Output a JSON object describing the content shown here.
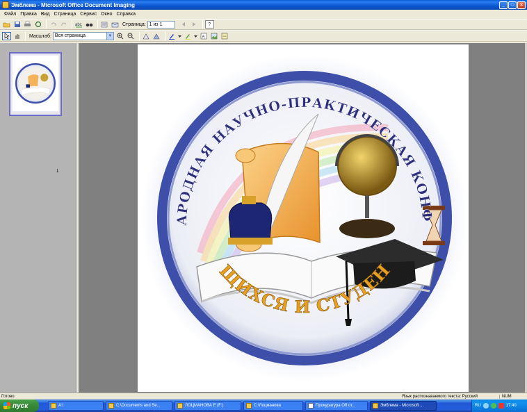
{
  "window": {
    "title": "Эмблема - Microsoft Office Document Imaging",
    "controls": [
      "_",
      "□",
      "×"
    ]
  },
  "menu": [
    "Файл",
    "Правка",
    "Вид",
    "Страница",
    "Сервис",
    "Окно",
    "Справка"
  ],
  "toolbar1": {
    "page_label": "Страница:",
    "page_value": "1 из 1",
    "help_icon": "?"
  },
  "toolbar2": {
    "zoom_label": "Масштаб:",
    "zoom_value": "Вся страница"
  },
  "thumbnail": {
    "page_number": "1"
  },
  "emblem": {
    "top_text": "МЕЖДУНАРОДНАЯ НАУЧНО-ПРАКТИЧЕСКАЯ КОНФЕРЕНЦИЯ",
    "bottom_text": "УЧАЩИХСЯ И СТУДЕНТОВ",
    "ring_color": "#3d4fa8",
    "text_color": "#2d2f7a",
    "bottom_text_color": "#e8a020"
  },
  "status": {
    "ready": "Готово",
    "language": "Язык распознаваемого текста: Русский",
    "num": "NUM"
  },
  "taskbar": {
    "start": "пуск",
    "tasks": [
      {
        "label": "A:\\",
        "active": false
      },
      {
        "label": "C:\\Documents and Se...",
        "active": false
      },
      {
        "label": "ЛОЦМАНОВА Е (F:)",
        "active": false
      },
      {
        "label": "C:\\Лоцманова",
        "active": false
      },
      {
        "label": "Прокуратура Об от...",
        "active": false
      },
      {
        "label": "Эмблема - Microsoft ...",
        "active": true
      }
    ],
    "tray_lang": "RU",
    "clock": "17:40"
  }
}
